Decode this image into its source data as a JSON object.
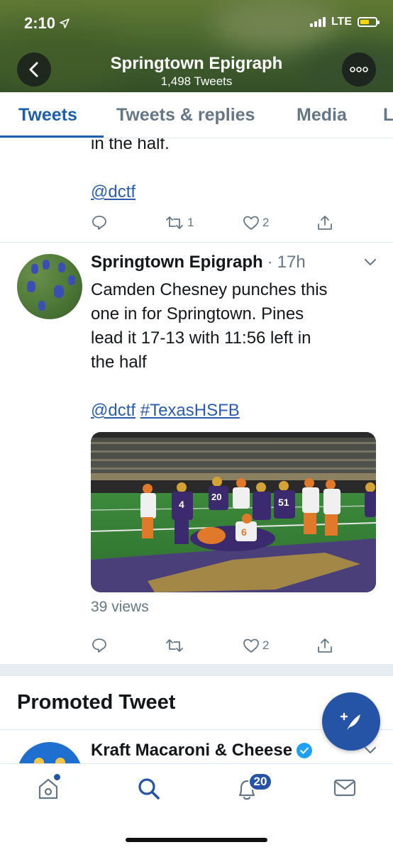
{
  "status_bar": {
    "time": "2:10",
    "carrier": "LTE"
  },
  "header": {
    "title": "Springtown Epigraph",
    "tweet_count": "1,498 Tweets"
  },
  "tabs": [
    {
      "label": "Tweets",
      "active": true
    },
    {
      "label": "Tweets & replies"
    },
    {
      "label": "Media"
    },
    {
      "label": "L"
    }
  ],
  "partial_tweet": {
    "text_fragment": "in the half.",
    "mention": "@dctf",
    "retweets": "1",
    "likes": "2"
  },
  "tweet": {
    "author": "Springtown Epigraph",
    "separator": "·",
    "time": "17h",
    "lines": [
      "Camden Chesney punches this",
      "one in for Springtown. Pines",
      "lead it 17-13 with 11:56 left in",
      "the half"
    ],
    "mention": "@dctf",
    "hashtag": "#TexasHSFB",
    "jersey_numbers": [
      "4",
      "20",
      "51",
      "6"
    ],
    "views": "39 views",
    "likes": "2"
  },
  "promoted": {
    "heading": "Promoted Tweet",
    "author": "Kraft Macaroni & Cheese"
  },
  "bottom_nav": {
    "notifications_badge": "20"
  },
  "colors": {
    "accent": "#2553a5",
    "link": "#2a5db0",
    "muted": "#657786"
  }
}
